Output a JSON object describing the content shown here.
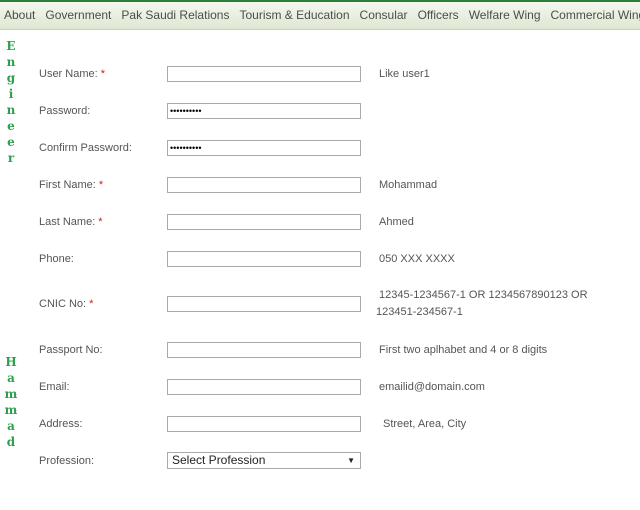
{
  "nav": {
    "items": [
      "About",
      "Government",
      "Pak Saudi Relations",
      "Tourism & Education",
      "Consular",
      "Officers",
      "Welfare Wing",
      "Commercial Wing"
    ]
  },
  "side_text": {
    "top": [
      "E",
      "n",
      "g",
      "i",
      "n",
      "e",
      "e",
      "r"
    ],
    "bottom": [
      "H",
      "a",
      "m",
      "m",
      "a",
      "d"
    ]
  },
  "form": {
    "required_marker": "*",
    "fields": [
      {
        "label": "User Name:",
        "required": true,
        "value": "",
        "hint": "Like user1"
      },
      {
        "label": "Password:",
        "required": false,
        "value": "••••••••••",
        "hint": ""
      },
      {
        "label": "Confirm Password:",
        "required": false,
        "value": "••••••••••",
        "hint": ""
      },
      {
        "label": "First Name:",
        "required": true,
        "value": "",
        "hint": "Mohammad"
      },
      {
        "label": "Last Name:",
        "required": true,
        "value": "",
        "hint": "Ahmed"
      },
      {
        "label": "Phone:",
        "required": false,
        "value": "",
        "hint": "050 XXX XXXX"
      },
      {
        "label": "CNIC No:",
        "required": true,
        "value": "",
        "hint": "12345-1234567-1 OR 1234567890123 OR",
        "hint2": "123451-234567-1"
      },
      {
        "label": "Passport No:",
        "required": false,
        "value": "",
        "hint": "First two aplhabet and 4 or 8 digits"
      },
      {
        "label": "Email:",
        "required": false,
        "value": "",
        "hint": "emailid@domain.com"
      },
      {
        "label": "Address:",
        "required": false,
        "value": "",
        "hint": "Street, Area, City"
      }
    ],
    "profession": {
      "label": "Profession:",
      "selected": "Select Profession",
      "caret": "▼"
    }
  }
}
